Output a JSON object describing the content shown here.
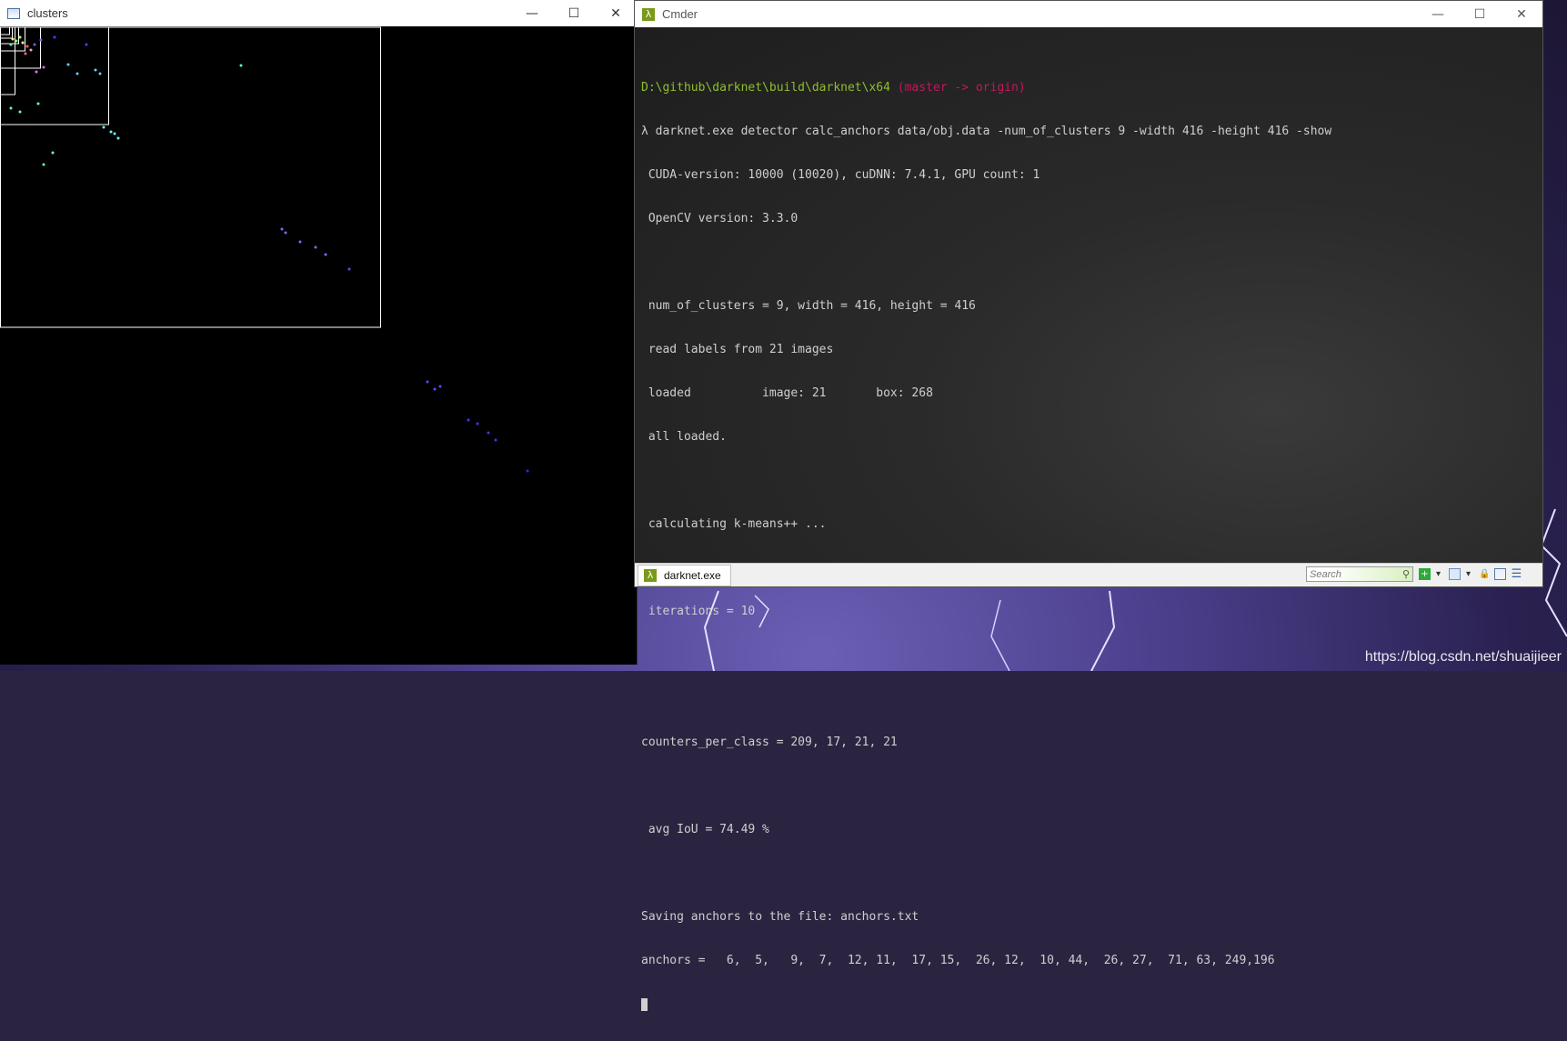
{
  "desktop": {
    "watermark": "https://blog.csdn.net/shuaijieer"
  },
  "clusters_window": {
    "title": "clusters",
    "controls": {
      "minimize": "—",
      "maximize": "☐",
      "close": "✕"
    }
  },
  "cmder_window": {
    "title": "Cmder",
    "controls": {
      "minimize": "—",
      "maximize": "☐",
      "close": "✕"
    },
    "prompt": {
      "path": "D:\\github\\darknet\\build\\darknet\\x64",
      "branch": "(master -> origin)"
    },
    "lines": [
      "λ darknet.exe detector calc_anchors data/obj.data -num_of_clusters 9 -width 416 -height 416 -show",
      " CUDA-version: 10000 (10020), cuDNN: 7.4.1, GPU count: 1",
      " OpenCV version: 3.3.0",
      "",
      " num_of_clusters = 9, width = 416, height = 416",
      " read labels from 21 images",
      " loaded          image: 21       box: 268",
      " all loaded.",
      "",
      " calculating k-means++ ...",
      "",
      " iterations = 10",
      "",
      "",
      "counters_per_class = 209, 17, 21, 21",
      "",
      " avg IoU = 74.49 %",
      "",
      "Saving anchors to the file: anchors.txt",
      "anchors =   6,  5,   9,  7,  12, 11,  17, 15,  26, 12,  10, 44,  26, 27,  71, 63, 249,196"
    ],
    "tab_label": "darknet.exe",
    "search_placeholder": "Search"
  },
  "colors": {
    "prompt_path": "#8fbe2e",
    "prompt_branch": "#c2185b",
    "terminal_text": "#cfcfcf"
  }
}
